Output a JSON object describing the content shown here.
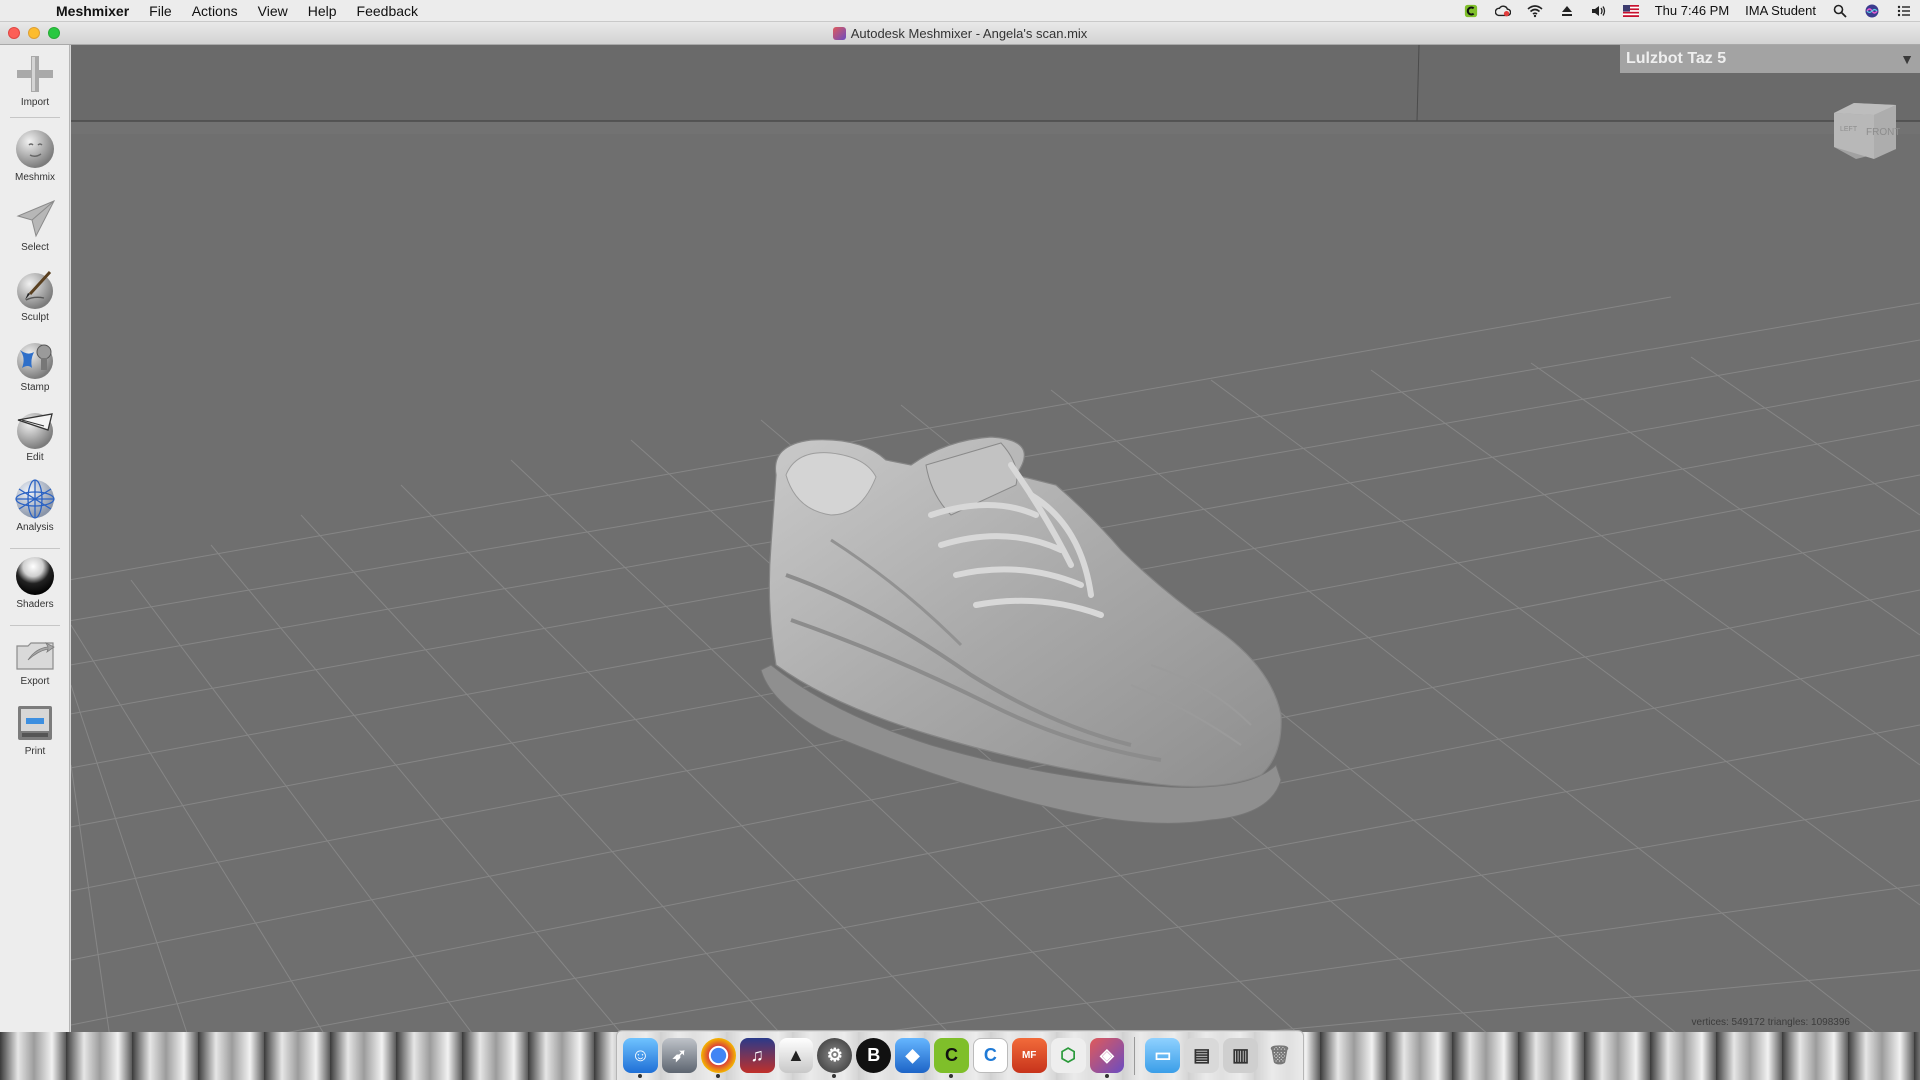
{
  "menubar": {
    "app_name": "Meshmixer",
    "items": [
      "File",
      "Actions",
      "View",
      "Help",
      "Feedback"
    ],
    "clock": "Thu 7:46 PM",
    "user": "IMA Student"
  },
  "window": {
    "title": "Autodesk Meshmixer - Angela's scan.mix"
  },
  "toolbar": {
    "tools": [
      {
        "label": "Import",
        "icon": "plus-icon"
      },
      {
        "label": "Meshmix",
        "icon": "sphere-face-icon"
      },
      {
        "label": "Select",
        "icon": "arrow-pointer-icon"
      },
      {
        "label": "Sculpt",
        "icon": "brush-sphere-icon"
      },
      {
        "label": "Stamp",
        "icon": "stamp-sphere-icon"
      },
      {
        "label": "Edit",
        "icon": "edit-sphere-icon"
      },
      {
        "label": "Analysis",
        "icon": "wire-sphere-icon"
      },
      {
        "label": "Shaders",
        "icon": "shaded-sphere-icon"
      },
      {
        "label": "Export",
        "icon": "export-folder-icon"
      },
      {
        "label": "Print",
        "icon": "printer-icon"
      }
    ]
  },
  "viewport": {
    "printer": "Lulzbot Taz 5",
    "viewcube_front": "FRONT",
    "viewcube_left": "LEFT",
    "stats": "vertices: 549172 triangles: 1098396"
  },
  "colors": {
    "viewport_bg": "#6f6f6f",
    "grid_line": "#8a8a8a",
    "printer_bar": "#a3a3a3"
  }
}
